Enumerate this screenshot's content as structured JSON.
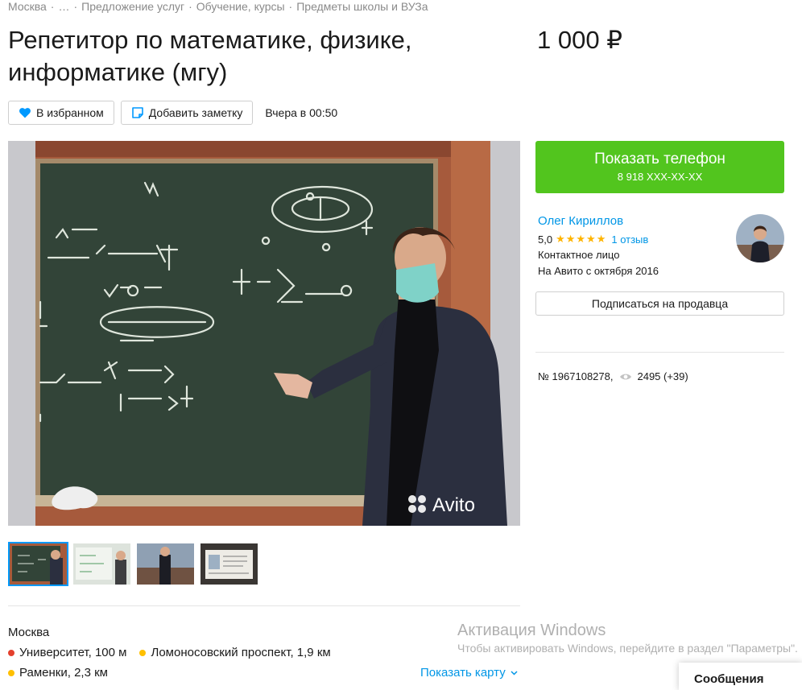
{
  "breadcrumb": [
    "Москва",
    "…",
    "Предложение услуг",
    "Обучение, курсы",
    "Предметы школы и ВУЗа"
  ],
  "listing": {
    "title": "Репетитор по математике, физике, информатике (мгу)",
    "price": "1 000 ₽",
    "favorite_label": "В избранном",
    "note_label": "Добавить заметку",
    "posted": "Вчера в 00:50",
    "watermark": "Avito",
    "id_text": "№ 1967108278,",
    "views": "2495 (+39)"
  },
  "contact": {
    "phone_label": "Показать телефон",
    "phone_masked": "8 918 XXX-XX-XX"
  },
  "seller": {
    "name": "Олег Кириллов",
    "rating": "5,0",
    "stars": "★★★★★",
    "reviews": "1 отзыв",
    "type": "Контактное лицо",
    "since": "На Авито с октября 2016",
    "subscribe_label": "Подписаться на продавца"
  },
  "location": {
    "city": "Москва",
    "metro": [
      {
        "name": "Университет, 100 м",
        "color": "#e4402d"
      },
      {
        "name": "Ломоносовский проспект, 1,9 км",
        "color": "#ffc000"
      },
      {
        "name": "Раменки, 2,3 км",
        "color": "#ffc000"
      }
    ],
    "show_map": "Показать карту"
  },
  "windows": {
    "title": "Активация Windows",
    "subtitle": "Чтобы активировать Windows, перейдите в раздел \"Параметры\"."
  },
  "chat": {
    "label": "Сообщения"
  },
  "colors": {
    "accent_green": "#52c51e",
    "link_blue": "#0096e6",
    "star": "#ffb400"
  }
}
